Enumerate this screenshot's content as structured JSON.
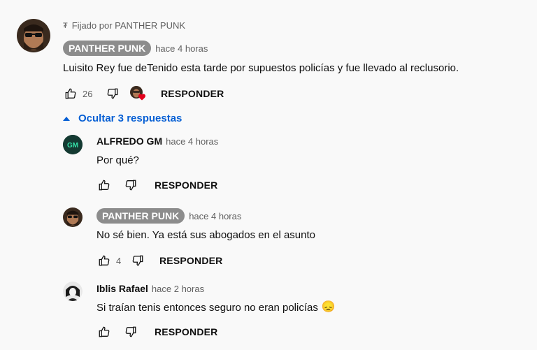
{
  "top_comment": {
    "pinned_text": "Fijado por PANTHER PUNK",
    "author": "PANTHER PUNK",
    "time": "hace 4 horas",
    "text": "Luisito Rey fue deTenido esta tarde por supuestos policías y fue llevado al reclusorio.",
    "likes": "26",
    "reply_label": "RESPONDER"
  },
  "replies_toggle": {
    "label": "Ocultar 3 respuestas"
  },
  "replies": [
    {
      "author": "ALFREDO GM",
      "time": "hace 4 horas",
      "text": "Por qué?",
      "likes": "",
      "reply_label": "RESPONDER",
      "avatar_initials": "GM"
    },
    {
      "author": "PANTHER PUNK",
      "time": "hace 4 horas",
      "text": "No sé bien. Ya está sus abogados en el asunto",
      "likes": "4",
      "reply_label": "RESPONDER"
    },
    {
      "author": "Iblis Rafael",
      "time": "hace 2 horas",
      "text": "Si traían tenis entonces seguro no eran policías",
      "emoji": "😞",
      "likes": "",
      "reply_label": "RESPONDER"
    }
  ],
  "colors": {
    "link_blue": "#065fd4",
    "badge_gray": "#8c8c8c",
    "heart_red": "#e3001b"
  }
}
